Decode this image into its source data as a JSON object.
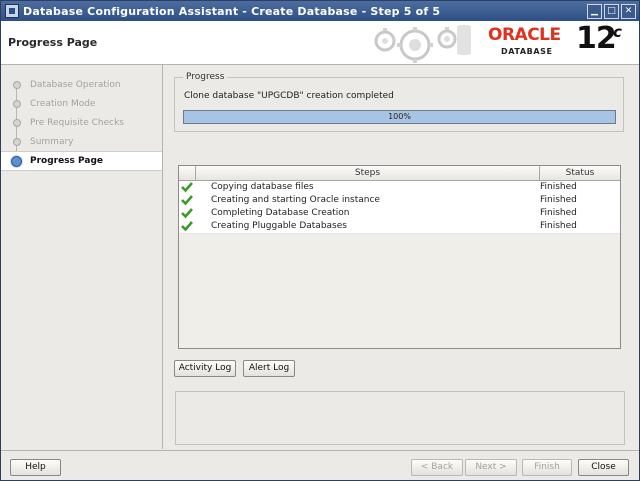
{
  "window": {
    "title": "Database Configuration Assistant - Create Database - Step 5 of 5",
    "controls": [
      "minimize-icon",
      "maximize-icon",
      "close-icon"
    ]
  },
  "header": {
    "page_title": "Progress Page",
    "logo": {
      "brand": "ORACLE",
      "product": "DATABASE",
      "version": "12",
      "version_suffix": "c"
    }
  },
  "sidebar": {
    "items": [
      {
        "label": "Database Operation",
        "state": "done"
      },
      {
        "label": "Creation Mode",
        "state": "done"
      },
      {
        "label": "Pre Requisite Checks",
        "state": "done"
      },
      {
        "label": "Summary",
        "state": "done"
      },
      {
        "label": "Progress Page",
        "state": "current"
      }
    ]
  },
  "progress": {
    "legend": "Progress",
    "message": "Clone database \"UPGCDB\" creation completed",
    "percent_text": "100%",
    "percent": 100
  },
  "steps_table": {
    "columns": [
      "Steps",
      "Status"
    ],
    "rows": [
      {
        "step": "Copying database files",
        "status": "Finished",
        "icon": "check-icon"
      },
      {
        "step": "Creating and starting Oracle instance",
        "status": "Finished",
        "icon": "check-icon"
      },
      {
        "step": "Completing Database Creation",
        "status": "Finished",
        "icon": "check-icon"
      },
      {
        "step": "Creating Pluggable Databases",
        "status": "Finished",
        "icon": "check-icon"
      }
    ]
  },
  "log_buttons": {
    "activity_log": "Activity Log",
    "alert_log": "Alert Log"
  },
  "footer": {
    "help": "Help",
    "back": "< Back",
    "next": "Next >",
    "finish": "Finish",
    "close": "Close"
  },
  "colors": {
    "title_bar": "#2d4f86",
    "oracle_red": "#e0311f",
    "progress_fill": "#a8c4e4",
    "check_green": "#3a9a2a"
  }
}
